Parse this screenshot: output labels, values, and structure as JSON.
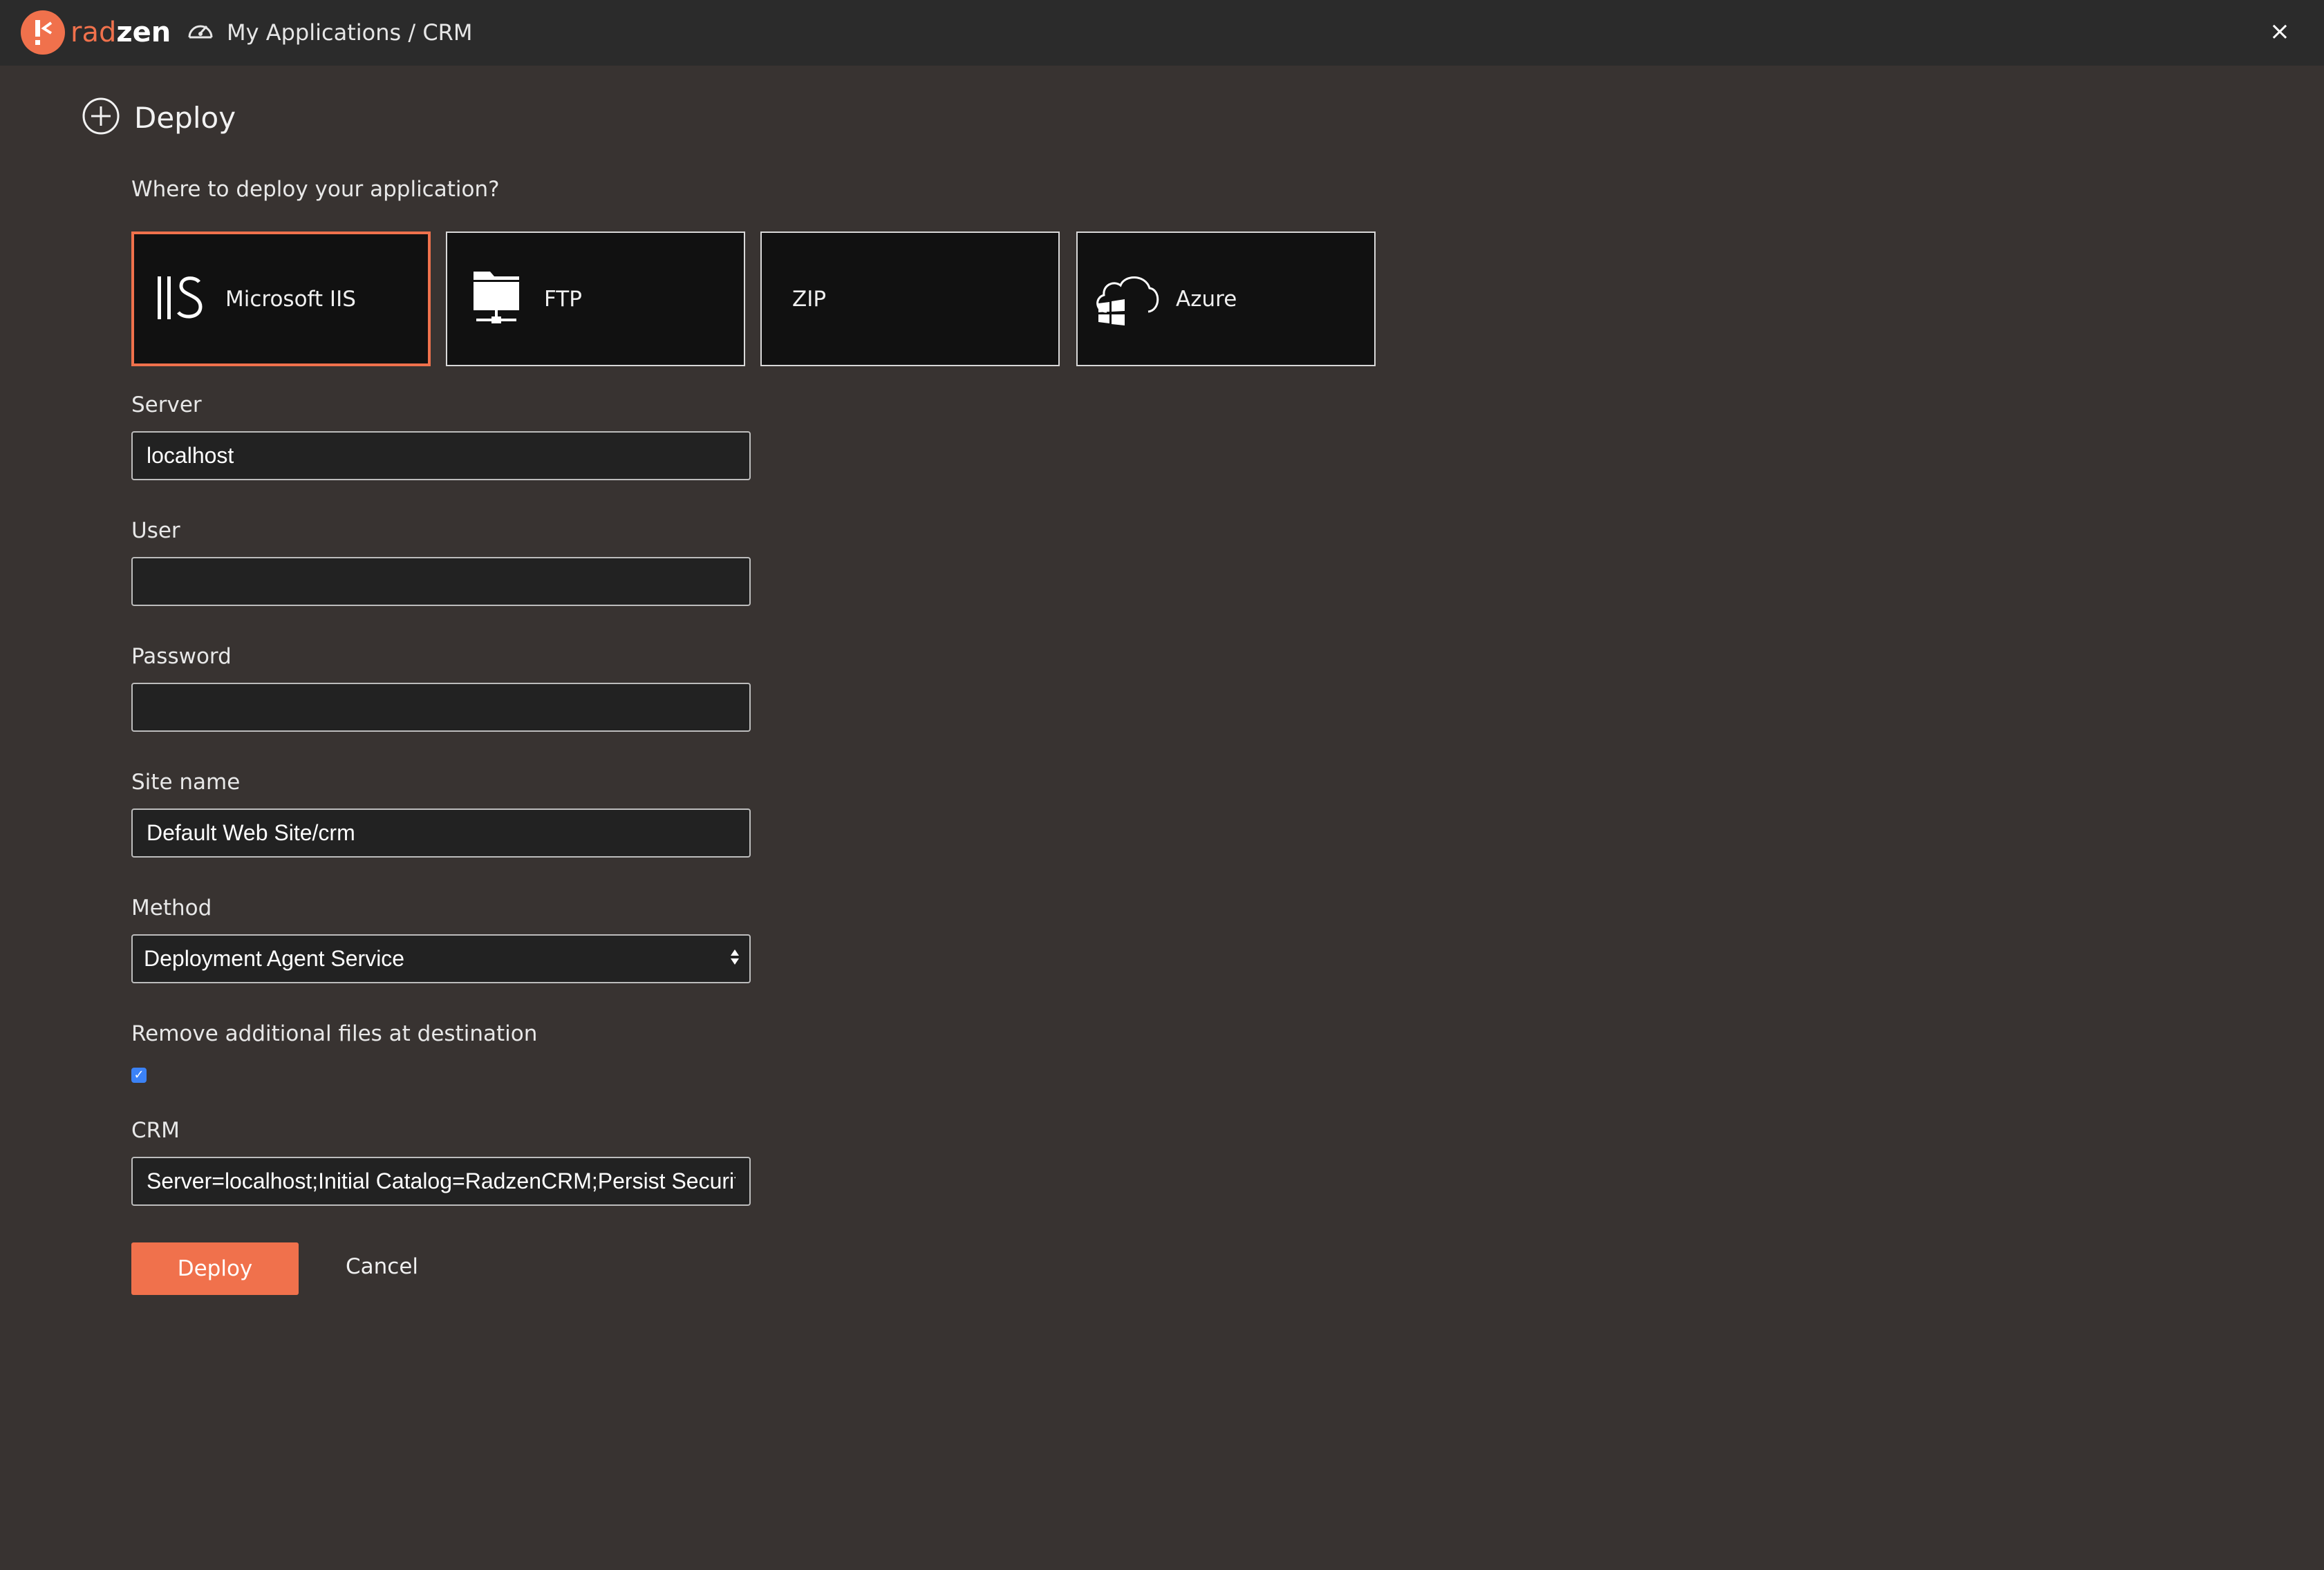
{
  "app": {
    "brand_part1": "rad",
    "brand_part2": "zen",
    "breadcrumb": "My Applications / CRM",
    "close_glyph": "×"
  },
  "page": {
    "title": "Deploy",
    "icon": "plus-circle-icon"
  },
  "deploy_question": "Where to deploy your application?",
  "targets": [
    {
      "label": "Microsoft IIS",
      "icon": "iis-icon",
      "selected": true
    },
    {
      "label": "FTP",
      "icon": "ftp-server-icon",
      "selected": false
    },
    {
      "label": "ZIP",
      "icon": "",
      "selected": false
    },
    {
      "label": "Azure",
      "icon": "azure-cloud-icon",
      "selected": false
    }
  ],
  "form": {
    "server": {
      "label": "Server",
      "value": "localhost"
    },
    "user": {
      "label": "User",
      "value": ""
    },
    "password": {
      "label": "Password",
      "value": ""
    },
    "site_name": {
      "label": "Site name",
      "value": "Default Web Site/crm"
    },
    "method": {
      "label": "Method",
      "value": "Deployment Agent Service"
    },
    "remove_files": {
      "label": "Remove additional files at destination",
      "checked": true
    },
    "crm": {
      "label": "CRM",
      "value": "Server=localhost;Initial Catalog=RadzenCRM;Persist Security Info=True"
    }
  },
  "actions": {
    "deploy": "Deploy",
    "cancel": "Cancel"
  },
  "colors": {
    "accent": "#f0714c",
    "background": "#383331",
    "topbar": "#2b2b2b",
    "tile": "#111111"
  }
}
